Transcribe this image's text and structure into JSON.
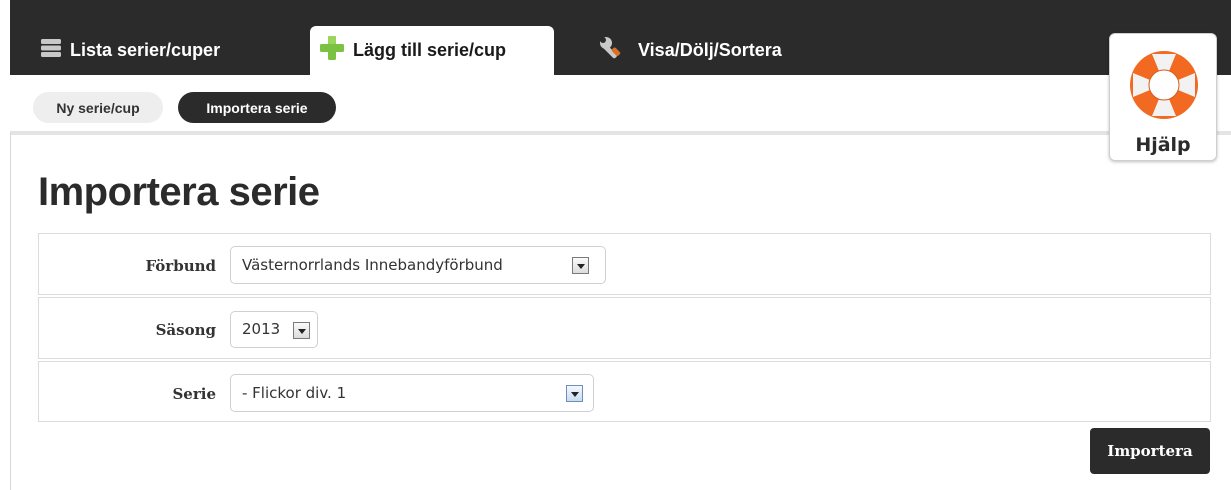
{
  "tabs": [
    {
      "label": "Lista serier/cuper",
      "icon": "list-icon"
    },
    {
      "label": "Lägg till serie/cup",
      "icon": "plus-icon"
    },
    {
      "label": "Visa/Dölj/Sortera",
      "icon": "wrench-icon"
    }
  ],
  "subnav": [
    {
      "label": "Ny serie/cup"
    },
    {
      "label": "Importera serie"
    }
  ],
  "help": {
    "label": "Hjälp",
    "icon": "lifebuoy-icon"
  },
  "page": {
    "title": "Importera serie"
  },
  "form": {
    "forbund": {
      "label": "Förbund",
      "value": "Västernorrlands Innebandyförbund"
    },
    "sasong": {
      "label": "Säsong",
      "value": "2013"
    },
    "serie": {
      "label": "Serie",
      "value": "- Flickor div. 1"
    }
  },
  "actions": {
    "import_label": "Importera"
  },
  "colors": {
    "dark": "#2b2b2b",
    "accent_green": "#7cc242",
    "help_orange": "#f26a21"
  }
}
